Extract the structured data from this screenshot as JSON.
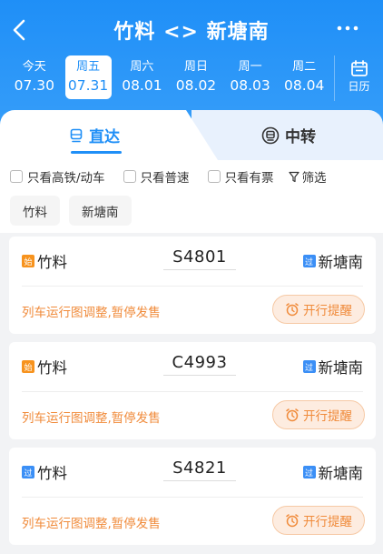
{
  "header": {
    "title": "竹料 <> 新塘南",
    "dates": [
      {
        "weekday": "今天",
        "date": "07.30",
        "selected": false
      },
      {
        "weekday": "周五",
        "date": "07.31",
        "selected": true
      },
      {
        "weekday": "周六",
        "date": "08.01",
        "selected": false
      },
      {
        "weekday": "周日",
        "date": "08.02",
        "selected": false
      },
      {
        "weekday": "周一",
        "date": "08.03",
        "selected": false
      },
      {
        "weekday": "周二",
        "date": "08.04",
        "selected": false
      }
    ],
    "calendar_label": "日历"
  },
  "tabs": {
    "direct": "直达",
    "transfer": "中转"
  },
  "filters": {
    "high_speed": "只看高铁/动车",
    "normal": "只看普速",
    "available": "只看有票",
    "filter": "筛选"
  },
  "stations": {
    "from": "竹料",
    "to": "新塘南"
  },
  "trains": [
    {
      "train_no": "S4801",
      "from": "竹料",
      "from_badge": "始",
      "from_type": "start",
      "to": "新塘南",
      "to_badge": "过",
      "note": "列车运行图调整,暂停发售",
      "remind_label": "开行提醒"
    },
    {
      "train_no": "C4993",
      "from": "竹料",
      "from_badge": "始",
      "from_type": "start",
      "to": "新塘南",
      "to_badge": "过",
      "note": "列车运行图调整,暂停发售",
      "remind_label": "开行提醒"
    },
    {
      "train_no": "S4821",
      "from": "竹料",
      "from_badge": "过",
      "from_type": "pass",
      "to": "新塘南",
      "to_badge": "过",
      "note": "列车运行图调整,暂停发售",
      "remind_label": "开行提醒"
    }
  ],
  "colors": {
    "primary": "#1f8ff7",
    "warning": "#f08b3b"
  }
}
